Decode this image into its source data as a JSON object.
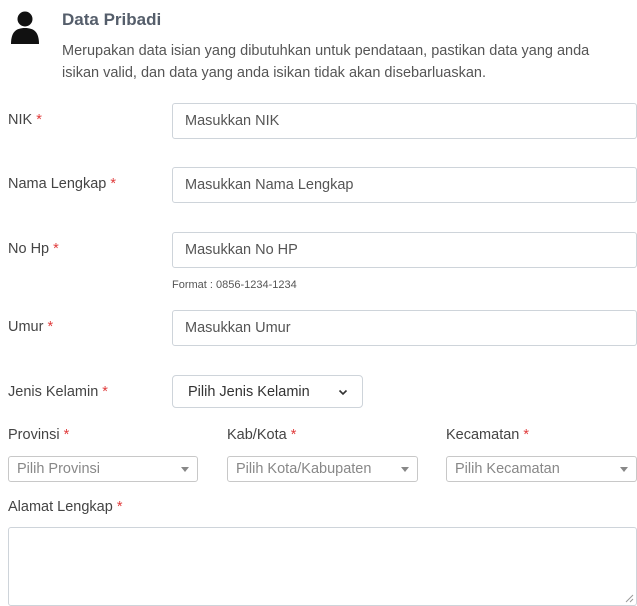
{
  "section": {
    "title": "Data Pribadi",
    "description": "Merupakan data isian yang dibutuhkan untuk pendataan, pastikan data yang anda isikan valid, dan data yang anda isikan tidak akan disebarluaskan.",
    "icon": "person-icon"
  },
  "required_marker": "*",
  "fields": {
    "nik": {
      "label": "NIK",
      "placeholder": "Masukkan NIK"
    },
    "nama": {
      "label": "Nama Lengkap",
      "placeholder": "Masukkan Nama Lengkap"
    },
    "nohp": {
      "label": "No Hp",
      "placeholder": "Masukkan No HP",
      "hint": "Format : 0856-1234-1234"
    },
    "umur": {
      "label": "Umur",
      "placeholder": "Masukkan Umur"
    },
    "gender": {
      "label": "Jenis Kelamin",
      "selected": "Pilih Jenis Kelamin"
    },
    "provinsi": {
      "label": "Provinsi",
      "selected": "Pilih Provinsi"
    },
    "kota": {
      "label": "Kab/Kota",
      "selected": "Pilih Kota/Kabupaten"
    },
    "kecamatan": {
      "label": "Kecamatan",
      "selected": "Pilih Kecamatan"
    },
    "alamat": {
      "label": "Alamat Lengkap",
      "value": ""
    }
  },
  "colors": {
    "required": "#e03b3b",
    "border": "#ced4da",
    "title": "#555e6b"
  }
}
